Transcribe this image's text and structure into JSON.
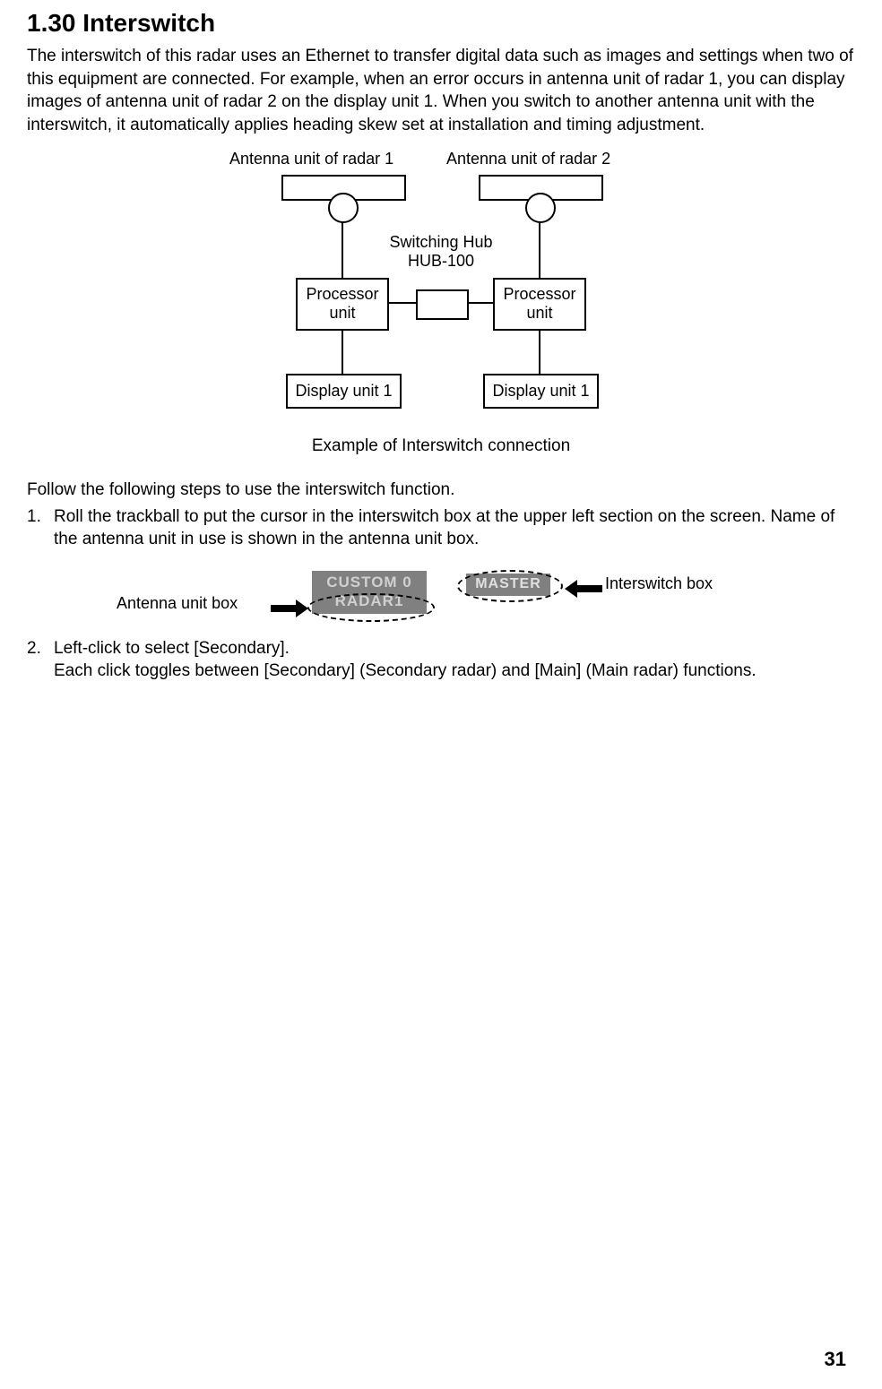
{
  "heading": "1.30 Interswitch",
  "intro": "The interswitch of this radar uses an Ethernet to transfer digital data such as images and settings when two of this equipment are connected. For example, when an error occurs in antenna unit of radar 1, you can display images of antenna unit of radar 2 on the display unit 1. When you switch to another antenna unit with the interswitch, it automatically applies heading skew set at installation and timing adjustment.",
  "diagram": {
    "antenna1": "Antenna unit of radar 1",
    "antenna2": "Antenna unit of radar 2",
    "hub_line1": "Switching Hub",
    "hub_line2": "HUB-100",
    "processor": "Processor unit",
    "display1": "Display unit 1",
    "display2": "Display unit 1",
    "caption": "Example of Interswitch connection"
  },
  "follow": "Follow the following steps to use the interswitch function.",
  "steps": [
    {
      "num": "1.",
      "text": "Roll the trackball to put the cursor in the interswitch box at the upper left section on the screen. Name of the antenna unit in use is shown in the antenna unit box."
    },
    {
      "num": "2.",
      "text": "Left-click to select [Secondary].\nEach click toggles between [Secondary] (Secondary radar) and [Main] (Main radar) functions."
    }
  ],
  "ui": {
    "antenna_box_label": "Antenna unit box",
    "interswitch_box_label": "Interswitch box",
    "custom_line1": "CUSTOM 0",
    "custom_line2": "RADAR1",
    "master": "MASTER"
  },
  "page_number": "31"
}
